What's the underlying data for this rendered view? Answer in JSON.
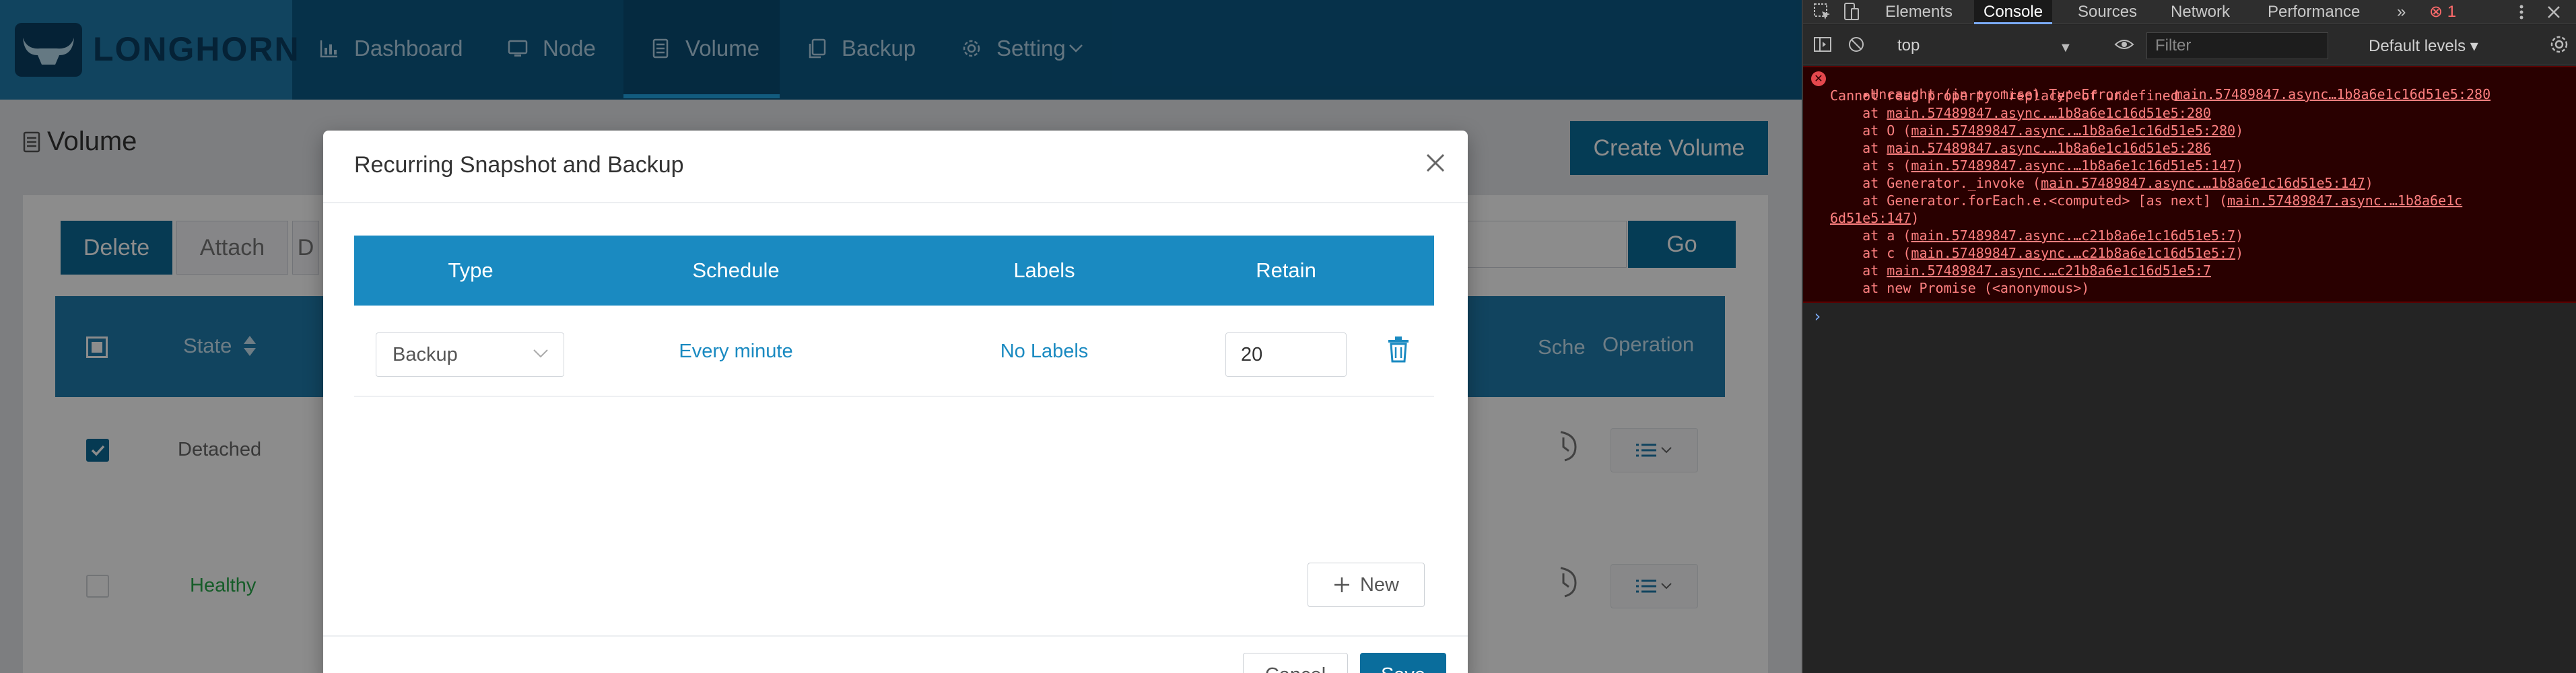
{
  "header": {
    "logo_text": "LONGHORN",
    "nav": [
      {
        "label": "Dashboard",
        "icon": "bar-chart-icon"
      },
      {
        "label": "Node",
        "icon": "monitor-icon"
      },
      {
        "label": "Volume",
        "icon": "volume-icon",
        "active": true
      },
      {
        "label": "Backup",
        "icon": "copy-icon"
      },
      {
        "label": "Setting",
        "icon": "gear-icon",
        "dropdown": true
      }
    ]
  },
  "page": {
    "title": "Volume",
    "create_button": "Create Volume",
    "toolbar": {
      "delete": "Delete",
      "attach": "Attach",
      "detach": "D",
      "go": "Go"
    },
    "table": {
      "headers": {
        "state": "State",
        "schedule": "Sche",
        "operation": "Operation"
      },
      "rows": [
        {
          "state": "Detached",
          "checked": true
        },
        {
          "state": "Healthy",
          "checked": false
        }
      ]
    }
  },
  "modal": {
    "title": "Recurring Snapshot and Backup",
    "columns": [
      "Type",
      "Schedule",
      "Labels",
      "Retain"
    ],
    "rows": [
      {
        "type": "Backup",
        "schedule": "Every minute",
        "labels": "No Labels",
        "retain": "20"
      }
    ],
    "new_button": "New",
    "cancel_button": "Cancel",
    "save_button": "Save"
  },
  "devtools": {
    "tabs": [
      "Elements",
      "Console",
      "Sources",
      "Network",
      "Performance"
    ],
    "active_tab": "Console",
    "more_tabs": "»",
    "error_count": "1",
    "context": "top",
    "filter_placeholder": "Filter",
    "levels": "Default levels ▾",
    "console_error": {
      "header": "▸Uncaught (in promise) TypeError:",
      "header_link": "main.57489847.async…1b8a6e1c16d51e5:280",
      "message": "Cannot read property 'replace' of undefined",
      "stack": [
        {
          "prefix": "    at ",
          "link": "main.57489847.async.…1b8a6e1c16d51e5:280",
          "suffix": ""
        },
        {
          "prefix": "    at O (",
          "link": "main.57489847.async.…1b8a6e1c16d51e5:280",
          "suffix": ")"
        },
        {
          "prefix": "    at ",
          "link": "main.57489847.async.…1b8a6e1c16d51e5:286",
          "suffix": ""
        },
        {
          "prefix": "    at s (",
          "link": "main.57489847.async.…1b8a6e1c16d51e5:147",
          "suffix": ")"
        },
        {
          "prefix": "    at Generator._invoke (",
          "link": "main.57489847.async.…1b8a6e1c16d51e5:147",
          "suffix": ")"
        },
        {
          "prefix": "    at Generator.forEach.e.<computed> [as next] (",
          "link": "main.57489847.async.…1b8a6e1c",
          "suffix": ""
        },
        {
          "prefix": "",
          "link": "6d51e5:147",
          "suffix": ")"
        },
        {
          "prefix": "    at a (",
          "link": "main.57489847.async.…c21b8a6e1c16d51e5:7",
          "suffix": ")"
        },
        {
          "prefix": "    at c (",
          "link": "main.57489847.async.…c21b8a6e1c16d51e5:7",
          "suffix": ")"
        },
        {
          "prefix": "    at ",
          "link": "main.57489847.async.…c21b8a6e1c16d51e5:7",
          "suffix": ""
        },
        {
          "prefix": "    at new Promise (<anonymous>)",
          "link": "",
          "suffix": ""
        }
      ]
    },
    "prompt": "›"
  },
  "colors": {
    "header_bg": "#0b5a86",
    "brand_blue": "#1f7dad",
    "primary_button": "#0a6d9c",
    "link": "#1a8ac1",
    "healthy_green": "#27a84a",
    "console_error": "#ff8080"
  }
}
